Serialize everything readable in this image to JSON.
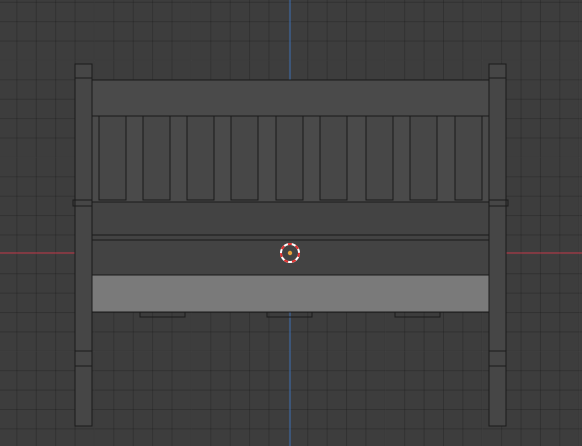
{
  "viewport": {
    "type": "3d-viewport",
    "background_color": "#3d3d3d",
    "x_axis_color": "#c5394a",
    "y_axis_color": "#3d6fb2",
    "object": "bench",
    "view": "front-orthographic",
    "cursor_icon": "3d-cursor-icon"
  }
}
